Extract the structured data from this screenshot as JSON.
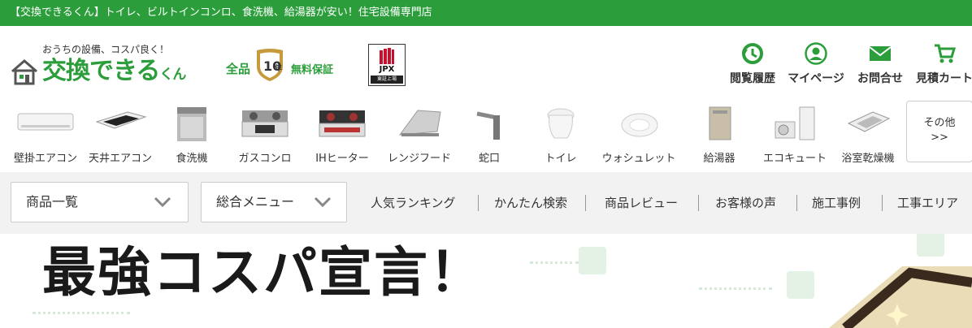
{
  "topbar": {
    "text": "【交換できるくん】トイレ、ビルトインコンロ、食洗機、給湯器が安い！住宅設備専門店"
  },
  "logo": {
    "tagline": "おうちの設備、コスパ良く！",
    "brand": "交換できる",
    "brand_small": "くん"
  },
  "warranty": {
    "left": "全品",
    "years": "10",
    "year_unit": "年",
    "right": "無料保証"
  },
  "jpx": {
    "text": "JPX",
    "sub": "東証上場"
  },
  "header_nav": [
    {
      "label": "閲覧履歴",
      "icon": "history-icon"
    },
    {
      "label": "マイページ",
      "icon": "user-icon"
    },
    {
      "label": "お問合せ",
      "icon": "mail-icon"
    },
    {
      "label": "見積カート",
      "icon": "cart-icon"
    }
  ],
  "categories": [
    {
      "label": "壁掛エアコン",
      "icon": "wall-aircon-icon"
    },
    {
      "label": "天井エアコン",
      "icon": "ceiling-aircon-icon"
    },
    {
      "label": "食洗機",
      "icon": "dishwasher-icon"
    },
    {
      "label": "ガスコンロ",
      "icon": "gas-stove-icon"
    },
    {
      "label": "IHヒーター",
      "icon": "ih-heater-icon"
    },
    {
      "label": "レンジフード",
      "icon": "range-hood-icon"
    },
    {
      "label": "蛇口",
      "icon": "faucet-icon"
    },
    {
      "label": "トイレ",
      "icon": "toilet-icon"
    },
    {
      "label": "ウォシュレット",
      "icon": "washlet-icon"
    },
    {
      "label": "給湯器",
      "icon": "water-heater-icon"
    },
    {
      "label": "エコキュート",
      "icon": "ecocute-icon"
    },
    {
      "label": "浴室乾燥機",
      "icon": "bathroom-dryer-icon"
    }
  ],
  "more": {
    "line1": "その他",
    "line2": ">>"
  },
  "menu": {
    "dropdown1": "商品一覧",
    "dropdown2": "総合メニュー",
    "links": [
      "人気ランキング",
      "かんたん検索",
      "商品レビュー",
      "お客様の声",
      "施工事例",
      "工事エリア"
    ]
  },
  "hero": {
    "title": "最強コスパ宣言！"
  },
  "colors": {
    "brand_green": "#2b9e3b",
    "menu_bg": "#f2f2f2"
  }
}
